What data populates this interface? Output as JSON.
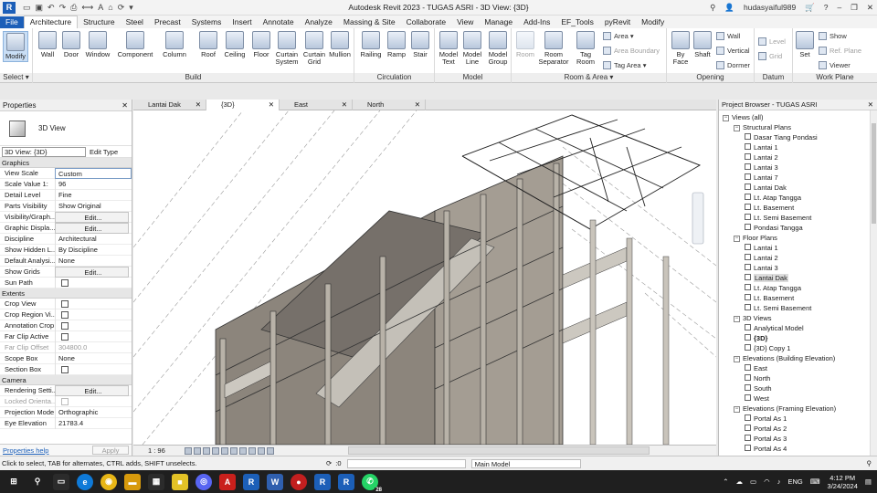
{
  "window": {
    "title": "Autodesk Revit 2023 - TUGAS ASRI - 3D View: {3D}",
    "user": "hudasyaiful989"
  },
  "ribbon_tabs": [
    "File",
    "Architecture",
    "Structure",
    "Steel",
    "Precast",
    "Systems",
    "Insert",
    "Annotate",
    "Analyze",
    "Massing & Site",
    "Collaborate",
    "View",
    "Manage",
    "Add-Ins",
    "EF_Tools",
    "pyRevit",
    "Modify"
  ],
  "ribbon": {
    "select": {
      "modify": "Modify",
      "select": "Select ▾"
    },
    "build": {
      "label": "Build",
      "buttons": [
        "Wall",
        "Door",
        "Window",
        "Component",
        "Column",
        "Roof",
        "Ceiling",
        "Floor",
        "Curtain System",
        "Curtain Grid",
        "Mullion"
      ]
    },
    "circulation": {
      "label": "Circulation",
      "buttons": [
        "Railing",
        "Ramp",
        "Stair"
      ]
    },
    "model": {
      "label": "Model",
      "buttons": [
        "Model Text",
        "Model Line",
        "Model Group"
      ]
    },
    "room": {
      "label": "Room & Area ▾",
      "buttons": [
        "Room",
        "Room Separator",
        "Tag Room"
      ],
      "small": [
        "Area ▾",
        "Area Boundary",
        "Tag Area ▾"
      ]
    },
    "opening": {
      "label": "Opening",
      "buttons": [
        "By Face",
        "Shaft"
      ],
      "small": [
        "Wall",
        "Vertical",
        "Dormer"
      ]
    },
    "datum": {
      "label": "Datum",
      "small": [
        "Level",
        "Grid"
      ]
    },
    "workplane": {
      "label": "Work Plane",
      "buttons": [
        "Set"
      ],
      "small": [
        "Show",
        "Ref. Plane",
        "Viewer"
      ]
    }
  },
  "properties": {
    "title": "Properties",
    "type_name": "3D View",
    "selector": "3D View: {3D}",
    "edit_type": "Edit Type",
    "sections": [
      {
        "name": "Graphics",
        "rows": [
          {
            "k": "View Scale",
            "v": "Custom",
            "kind": "input"
          },
          {
            "k": "Scale Value    1:",
            "v": "96"
          },
          {
            "k": "Detail Level",
            "v": "Fine"
          },
          {
            "k": "Parts Visibility",
            "v": "Show Original"
          },
          {
            "k": "Visibility/Graph...",
            "v": "Edit...",
            "kind": "btn"
          },
          {
            "k": "Graphic Displa...",
            "v": "Edit...",
            "kind": "btn"
          },
          {
            "k": "Discipline",
            "v": "Architectural"
          },
          {
            "k": "Show Hidden L...",
            "v": "By Discipline"
          },
          {
            "k": "Default Analysi...",
            "v": "None"
          },
          {
            "k": "Show Grids",
            "v": "Edit...",
            "kind": "btn"
          },
          {
            "k": "Sun Path",
            "v": "",
            "kind": "cb"
          }
        ]
      },
      {
        "name": "Extents",
        "rows": [
          {
            "k": "Crop View",
            "v": "",
            "kind": "cb"
          },
          {
            "k": "Crop Region Vi...",
            "v": "",
            "kind": "cb"
          },
          {
            "k": "Annotation Crop",
            "v": "",
            "kind": "cb"
          },
          {
            "k": "Far Clip Active",
            "v": "",
            "kind": "cb"
          },
          {
            "k": "Far Clip Offset",
            "v": "304800.0",
            "kind": "grey"
          },
          {
            "k": "Scope Box",
            "v": "None"
          },
          {
            "k": "Section Box",
            "v": "",
            "kind": "cb"
          }
        ]
      },
      {
        "name": "Camera",
        "rows": [
          {
            "k": "Rendering Setti...",
            "v": "Edit...",
            "kind": "btn"
          },
          {
            "k": "Locked Orienta...",
            "v": "",
            "kind": "cbgrey"
          },
          {
            "k": "Projection Mode",
            "v": "Orthographic"
          },
          {
            "k": "Eye Elevation",
            "v": "21783.4"
          }
        ]
      }
    ],
    "help": "Properties help",
    "apply": "Apply"
  },
  "view_tabs": [
    {
      "label": "Lantai Dak",
      "active": false
    },
    {
      "label": "{3D}",
      "active": true
    },
    {
      "label": "East",
      "active": false
    },
    {
      "label": "North",
      "active": false
    }
  ],
  "view_bar": {
    "scale": "1 : 96"
  },
  "browser": {
    "title": "Project Browser - TUGAS ASRI",
    "tree": [
      {
        "label": "Views (all)",
        "level": 0,
        "type": "group"
      },
      {
        "label": "Structural Plans",
        "level": 1,
        "type": "group"
      },
      {
        "label": "Dasar Tiang Pondasi",
        "level": 2
      },
      {
        "label": "Lantai 1",
        "level": 2
      },
      {
        "label": "Lantai 2",
        "level": 2
      },
      {
        "label": "Lantai 3",
        "level": 2
      },
      {
        "label": "Lantai 7",
        "level": 2
      },
      {
        "label": "Lantai Dak",
        "level": 2
      },
      {
        "label": "Lt. Atap Tangga",
        "level": 2
      },
      {
        "label": "Lt. Basement",
        "level": 2
      },
      {
        "label": "Lt. Semi Basement",
        "level": 2
      },
      {
        "label": "Pondasi Tangga",
        "level": 2
      },
      {
        "label": "Floor Plans",
        "level": 1,
        "type": "group"
      },
      {
        "label": "Lantai 1",
        "level": 2
      },
      {
        "label": "Lantai 2",
        "level": 2
      },
      {
        "label": "Lantai 3",
        "level": 2
      },
      {
        "label": "Lantai Dak",
        "level": 2,
        "selected": true
      },
      {
        "label": "Lt. Atap Tangga",
        "level": 2
      },
      {
        "label": "Lt. Basement",
        "level": 2
      },
      {
        "label": "Lt. Semi Basement",
        "level": 2
      },
      {
        "label": "3D Views",
        "level": 1,
        "type": "group"
      },
      {
        "label": "Analytical Model",
        "level": 2
      },
      {
        "label": "{3D}",
        "level": 2,
        "bold": true
      },
      {
        "label": "{3D} Copy 1",
        "level": 2
      },
      {
        "label": "Elevations (Building Elevation)",
        "level": 1,
        "type": "group"
      },
      {
        "label": "East",
        "level": 2
      },
      {
        "label": "North",
        "level": 2
      },
      {
        "label": "South",
        "level": 2
      },
      {
        "label": "West",
        "level": 2
      },
      {
        "label": "Elevations (Framing Elevation)",
        "level": 1,
        "type": "group"
      },
      {
        "label": "Portal As 1",
        "level": 2
      },
      {
        "label": "Portal As 2",
        "level": 2
      },
      {
        "label": "Portal As 3",
        "level": 2
      },
      {
        "label": "Portal As 4",
        "level": 2
      }
    ]
  },
  "status": {
    "message": "Click to select, TAB for alternates, CTRL adds, SHIFT unselects.",
    "zero": ":0",
    "model": "Main Model"
  },
  "taskbar": {
    "lang": "ENG",
    "time": "4:12 PM",
    "date": "3/24/2024",
    "wa_badge": "28"
  }
}
